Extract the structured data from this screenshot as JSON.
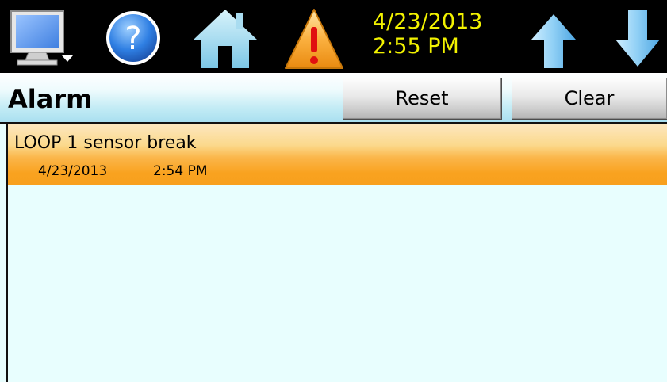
{
  "toolbar": {
    "date": "4/23/2013",
    "time": "2:55 PM",
    "icons": {
      "monitor": "monitor-icon",
      "help": "help-icon",
      "home": "home-icon",
      "alarm": "warning-icon",
      "up": "arrow-up-icon",
      "down": "arrow-down-icon"
    },
    "datetime_color": "#f2f200"
  },
  "header": {
    "title": "Alarm",
    "reset_label": "Reset",
    "clear_label": "Clear"
  },
  "alarms": [
    {
      "message": "LOOP 1 sensor break",
      "date": "4/23/2013",
      "time": "2:54 PM",
      "color": "#f9a21f"
    }
  ]
}
